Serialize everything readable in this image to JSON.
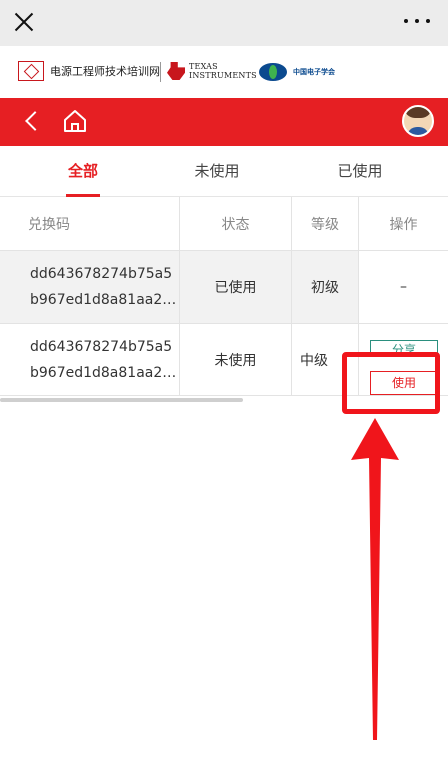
{
  "topbar": {
    "close_icon": "close-icon",
    "more_icon": "more-icon"
  },
  "logos": {
    "training_net": "电源工程师技术培训网",
    "ti_line1": "TEXAS",
    "ti_line2": "INSTRUMENTS",
    "cie_text": "中国电子学会"
  },
  "nav": {
    "back_icon": "back-chevron-icon",
    "home_icon": "home-icon",
    "avatar": "avatar"
  },
  "tabs": [
    {
      "label": "全部",
      "active": true
    },
    {
      "label": "未使用",
      "active": false
    },
    {
      "label": "已使用",
      "active": false
    }
  ],
  "table": {
    "headers": [
      "兑换码",
      "状态",
      "等级",
      "操作"
    ],
    "rows": [
      {
        "code_line1": "dd643678274b75a5",
        "code_line2": "b967ed1d8a81aa2…",
        "status": "已使用",
        "grade": "初级",
        "action": "–"
      },
      {
        "code_line1": "dd643678274b75a5",
        "code_line2": "b967ed1d8a81aa2…",
        "status": "未使用",
        "grade": "中级",
        "share_label": "分享",
        "use_label": "使用"
      }
    ]
  },
  "colors": {
    "brand_red": "#e61f23",
    "action_green": "#2a8f7e",
    "annotation_red": "#f0151b"
  }
}
